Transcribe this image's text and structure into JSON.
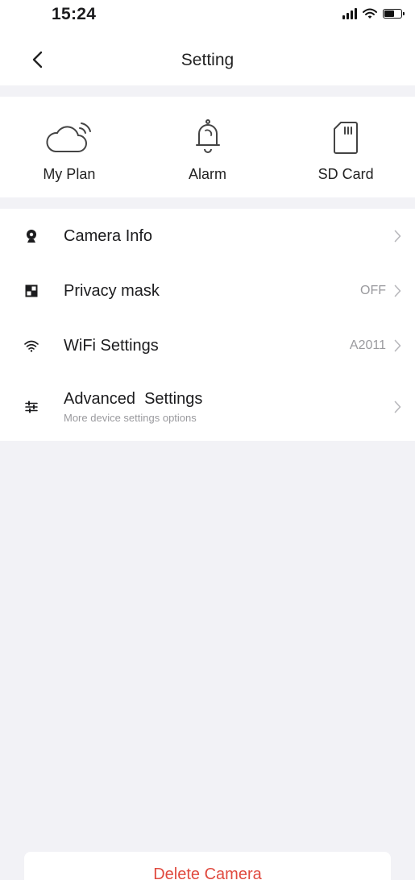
{
  "status": {
    "time": "15:24"
  },
  "nav": {
    "title": "Setting"
  },
  "quick": [
    {
      "label": "My Plan",
      "icon": "cloud-icon"
    },
    {
      "label": "Alarm",
      "icon": "bell-icon"
    },
    {
      "label": "SD Card",
      "icon": "sd-card-icon"
    }
  ],
  "settings": [
    {
      "label": "Camera Info",
      "value": "",
      "subtitle": "",
      "icon": "camera-icon"
    },
    {
      "label": "Privacy mask",
      "value": "OFF",
      "subtitle": "",
      "icon": "privacy-mask-icon"
    },
    {
      "label": "WiFi Settings",
      "value": "A2011",
      "subtitle": "",
      "icon": "wifi-icon"
    },
    {
      "label": "Advanced  Settings",
      "value": "",
      "subtitle": "More device settings options",
      "icon": "sliders-icon"
    }
  ],
  "delete_label": "Delete Camera",
  "colors": {
    "danger": "#e04a3f",
    "background": "#f2f2f6"
  }
}
